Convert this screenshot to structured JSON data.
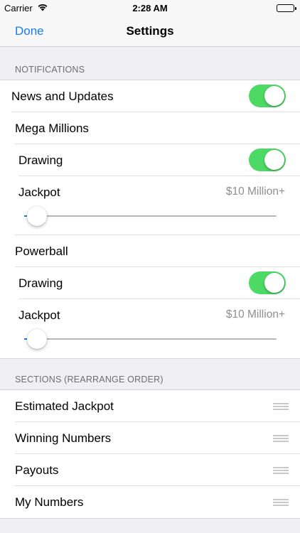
{
  "status_bar": {
    "carrier": "Carrier",
    "time": "2:28 AM",
    "wifi_icon": "wifi-icon",
    "battery_icon": "battery-icon"
  },
  "nav": {
    "done_label": "Done",
    "title": "Settings"
  },
  "notifications": {
    "header": "NOTIFICATIONS",
    "news_label": "News and Updates",
    "news_on": true,
    "mega_millions": {
      "label": "Mega Millions",
      "drawing_label": "Drawing",
      "drawing_on": true,
      "jackpot_label": "Jackpot",
      "jackpot_value": "$10 Million+",
      "slider_fraction": 0.03
    },
    "powerball": {
      "label": "Powerball",
      "drawing_label": "Drawing",
      "drawing_on": true,
      "jackpot_label": "Jackpot",
      "jackpot_value": "$10 Million+",
      "slider_fraction": 0.03
    }
  },
  "sections": {
    "header": "SECTIONS (REARRANGE ORDER)",
    "items": [
      {
        "label": "Estimated Jackpot"
      },
      {
        "label": "Winning Numbers"
      },
      {
        "label": "Payouts"
      },
      {
        "label": "My Numbers"
      }
    ]
  },
  "colors": {
    "accent": "#1a7ee0",
    "switch_on": "#4cd964",
    "background": "#efeff4"
  }
}
